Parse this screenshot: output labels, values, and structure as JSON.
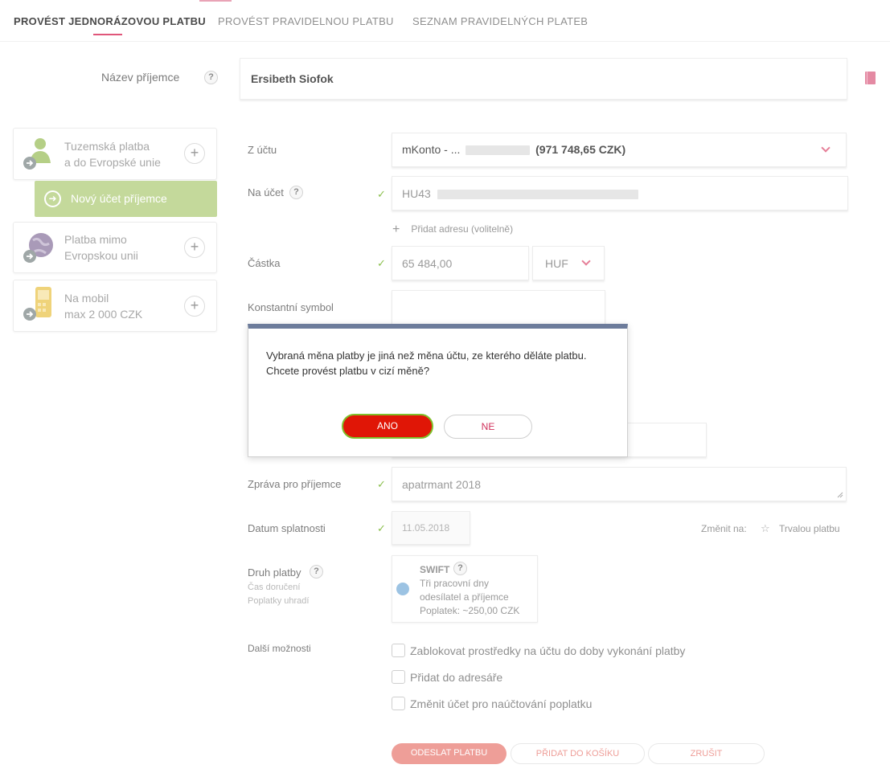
{
  "tabs": [
    {
      "label": "PROVÉST JEDNORÁZOVOU PLATBU",
      "active": true
    },
    {
      "label": "PROVÉST PRAVIDELNOU PLATBU",
      "active": false
    },
    {
      "label": "SEZNAM PRAVIDELNÝCH PLATEB",
      "active": false
    }
  ],
  "recipient": {
    "label": "Název příjemce",
    "value": "Ersibeth Siofok"
  },
  "help_glyph": "?",
  "sidebar": {
    "domestic": {
      "line1": "Tuzemská platba",
      "line2": "a do Evropské unie"
    },
    "new_recipient": "Nový účet příjemce",
    "outside_eu": {
      "line1": "Platba mimo",
      "line2": "Evropskou unii"
    },
    "mobile": {
      "line1": "Na mobil",
      "line2": "max 2 000 CZK"
    }
  },
  "form": {
    "from_account": {
      "label": "Z účtu",
      "prefix": "mKonto - ...",
      "balance": "(971 748,65 CZK)"
    },
    "to_account": {
      "label": "Na účet",
      "prefix": "HU43"
    },
    "add_address": "Přidat adresu (volitelně)",
    "amount": {
      "label": "Částka",
      "value": "65 484,00",
      "currency": "HUF"
    },
    "constant_symbol": {
      "label": "Konstantní symbol"
    },
    "message": {
      "label": "Zpráva pro příjemce",
      "value": "apatrmant 2018"
    },
    "due_date": {
      "label": "Datum splatnosti",
      "value": "11.05.2018"
    },
    "change_to": {
      "label": "Změnit na:",
      "option": "Trvalou platbu"
    },
    "payment_type": {
      "label": "Druh platby",
      "sub1": "Čas doručení",
      "sub2": "Poplatky uhradí",
      "swift": {
        "title": "SWIFT",
        "line1": "Tři pracovní dny",
        "line2": "odesílatel a příjemce",
        "line3": "Poplatek: ~250,00 CZK"
      }
    },
    "other_options": {
      "label": "Další možnosti",
      "items": [
        "Zablokovat prostředky na účtu do doby vykonání platby",
        "Přidat do adresáře",
        "Změnit účet pro naúčtování poplatku"
      ]
    }
  },
  "actions": {
    "send": "ODESLAT PLATBU",
    "add_to_cart": "PŘIDAT DO KOŠÍKU",
    "cancel": "ZRUŠIT"
  },
  "modal": {
    "message": "Vybraná měna platby je jiná než měna účtu, ze kterého děláte platbu. Chcete provést platbu v cizí měně?",
    "yes": "ANO",
    "no": "NE"
  },
  "colors": {
    "accent": "#e0567a",
    "green": "#c4d99b",
    "yes_button": "#e01606",
    "modal_bar": "#6d7c9b"
  }
}
